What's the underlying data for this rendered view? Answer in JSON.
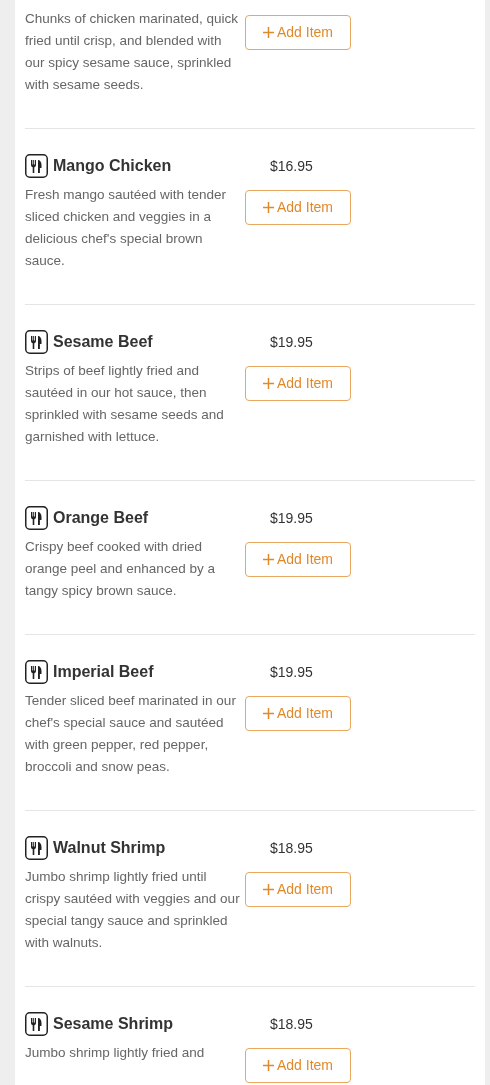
{
  "items": [
    {
      "description": "Chunks of chicken marinated, quick fried until crisp, and blended with our spicy sesame sauce, sprinkled with sesame seeds.",
      "button": "Add Item"
    },
    {
      "name": "Mango Chicken",
      "price": "$16.95",
      "description": "Fresh mango sautéed with tender sliced chicken and veggies in a delicious chef's special brown sauce.",
      "button": "Add Item"
    },
    {
      "name": "Sesame Beef",
      "price": "$19.95",
      "description": "Strips of beef lightly fried and sautéed in our hot sauce, then sprinkled with sesame seeds and garnished with lettuce.",
      "button": "Add Item"
    },
    {
      "name": "Orange Beef",
      "price": "$19.95",
      "description": "Crispy beef cooked with dried orange peel and enhanced by a tangy spicy brown sauce.",
      "button": "Add Item"
    },
    {
      "name": "Imperial Beef",
      "price": "$19.95",
      "description": "Tender sliced beef marinated in our chef's special sauce and sautéed with green pepper, red pepper, broccoli and snow peas.",
      "button": "Add Item"
    },
    {
      "name": "Walnut Shrimp",
      "price": "$18.95",
      "description": "Jumbo shrimp lightly fried until crispy sautéed with veggies and our special tangy sauce and sprinkled with walnuts.",
      "button": "Add Item"
    },
    {
      "name": "Sesame Shrimp",
      "price": "$18.95",
      "description": "Jumbo shrimp lightly fried and",
      "button": "Add Item"
    }
  ]
}
